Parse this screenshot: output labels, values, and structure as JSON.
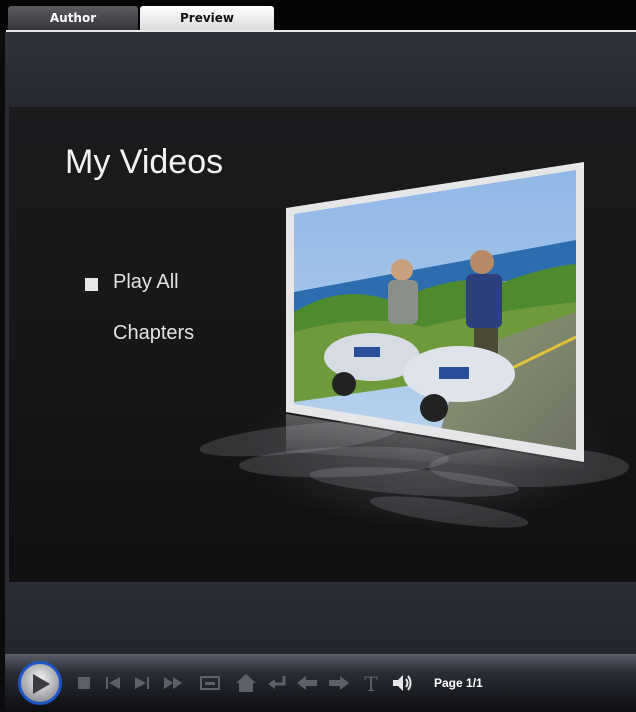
{
  "tabs": [
    {
      "label": "Author",
      "active": false
    },
    {
      "label": "Preview",
      "active": true
    }
  ],
  "menu": {
    "title": "My Videos",
    "items": [
      {
        "label": "Play All",
        "selected": true
      },
      {
        "label": "Chapters",
        "selected": false
      }
    ],
    "thumbnail_icon": "scooter-photo"
  },
  "player": {
    "page_label": "Page 1/1",
    "controls": [
      "play-icon",
      "stop-icon",
      "previous-chapter-icon",
      "next-chapter-icon",
      "fast-forward-icon",
      "subtitle-icon",
      "home-icon",
      "return-icon",
      "arrow-left-icon",
      "arrow-right-icon",
      "text-icon",
      "volume-icon"
    ],
    "accent_color": "#1e56c8"
  }
}
